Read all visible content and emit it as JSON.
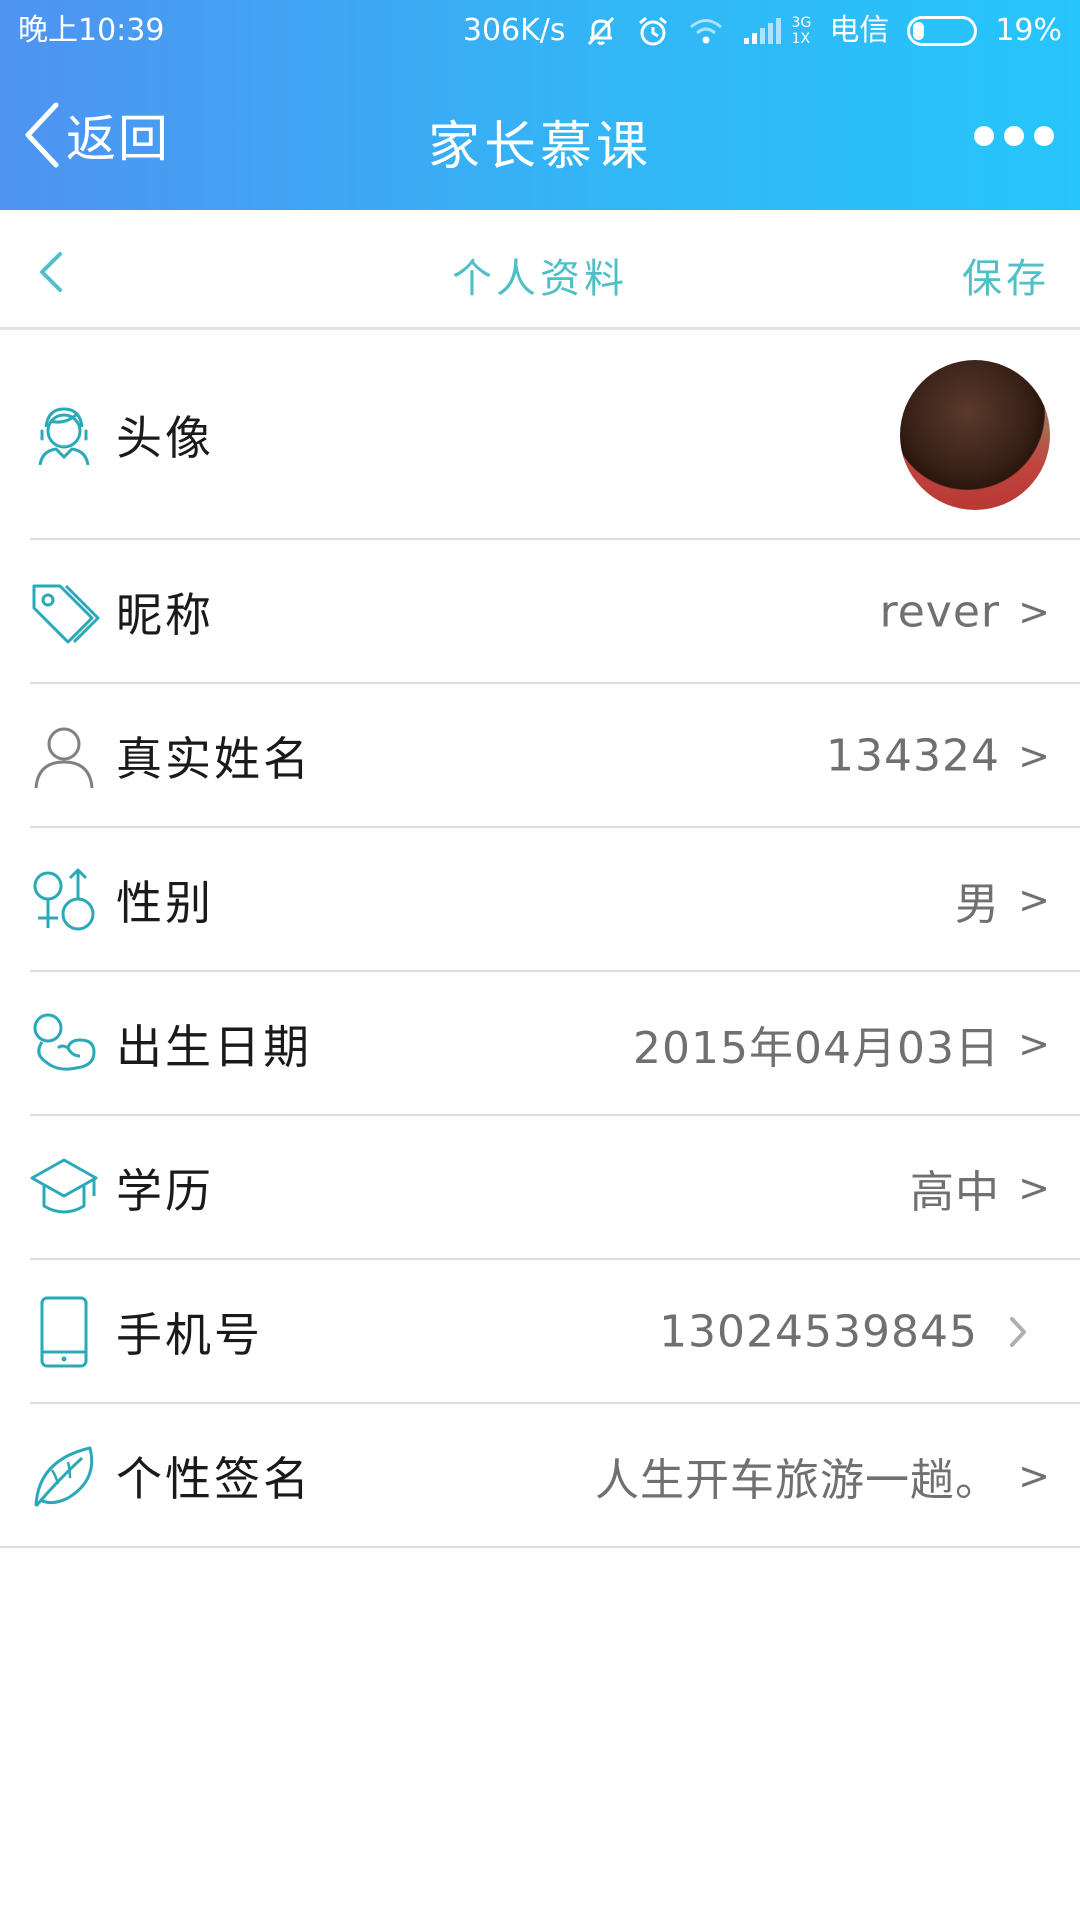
{
  "status_bar": {
    "time": "晚上10:39",
    "speed": "306K/s",
    "net_top": "3G",
    "net_bottom": "1X",
    "carrier": "电信",
    "battery": "19%",
    "battery_level": 0.19
  },
  "header": {
    "back_label": "返回",
    "title": "家长慕课"
  },
  "subheader": {
    "title": "个人资料",
    "save_label": "保存"
  },
  "profile": {
    "chevron": ">",
    "rows": [
      {
        "label": "头像",
        "icon": "face-icon"
      },
      {
        "label": "昵称",
        "value": "rever",
        "icon": "tag-icon"
      },
      {
        "label": "真实姓名",
        "value": "134324",
        "icon": "person-icon"
      },
      {
        "label": "性别",
        "value": "男",
        "icon": "gender-icon"
      },
      {
        "label": "出生日期",
        "value": "2015年04月03日",
        "icon": "baby-icon"
      },
      {
        "label": "学历",
        "value": "高中",
        "icon": "graduation-cap-icon"
      },
      {
        "label": "手机号",
        "value": "13024539845",
        "icon": "phone-icon"
      },
      {
        "label": "个性签名",
        "value": "人生开车旅游一趟。",
        "icon": "leaf-icon"
      }
    ]
  },
  "colors": {
    "accent": "#4fc0c8",
    "header_start": "#4f93f1",
    "header_end": "#26c5fb"
  }
}
